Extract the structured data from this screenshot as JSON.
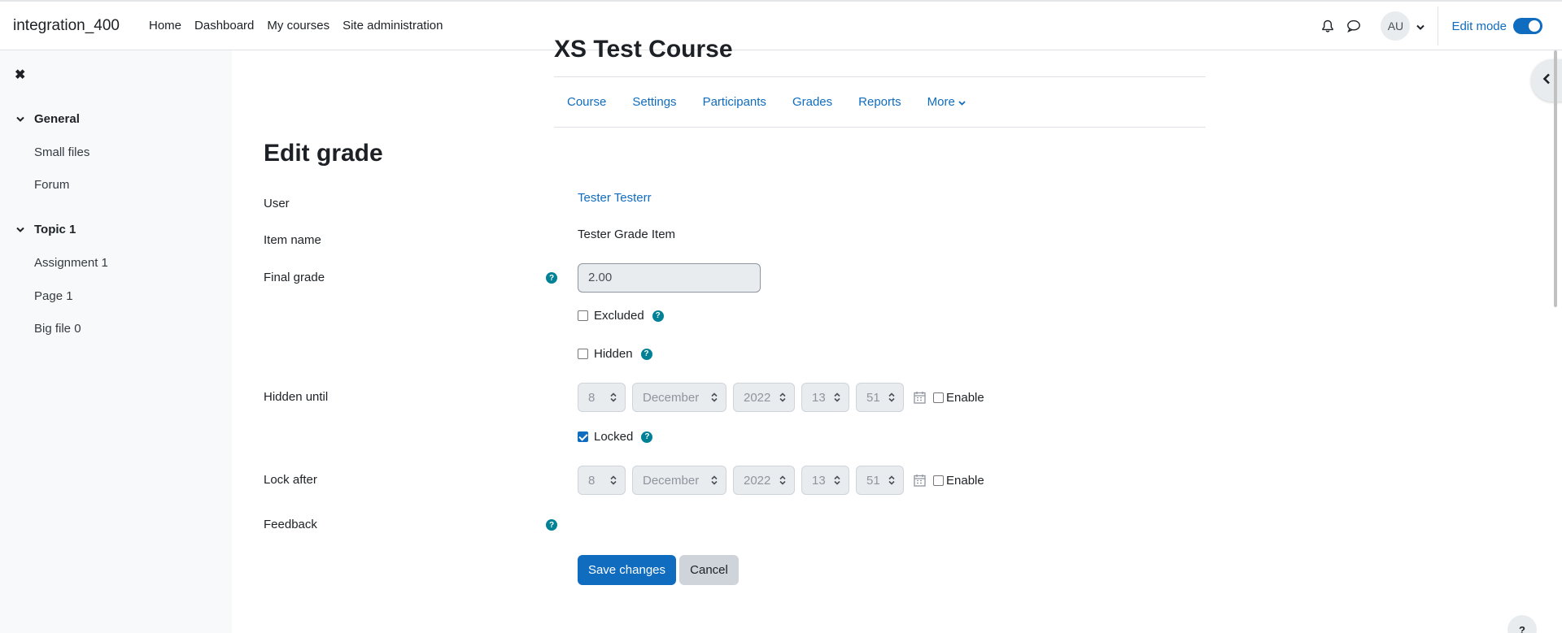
{
  "navbar": {
    "brand": "integration_400",
    "links": [
      "Home",
      "Dashboard",
      "My courses",
      "Site administration"
    ],
    "avatar_initials": "AU",
    "edit_mode_label": "Edit mode",
    "edit_mode_on": true
  },
  "drawer": {
    "close_icon": "close-icon",
    "sections": [
      {
        "title": "General",
        "items": [
          "Small files",
          "Forum"
        ]
      },
      {
        "title": "Topic 1",
        "items": [
          "Assignment 1",
          "Page 1",
          "Big file 0"
        ]
      }
    ]
  },
  "course": {
    "title": "XS Test Course",
    "tabs": [
      "Course",
      "Settings",
      "Participants",
      "Grades",
      "Reports",
      "More"
    ]
  },
  "form": {
    "page_title": "Edit grade",
    "user_label": "User",
    "user_value": "Tester Testerr",
    "item_name_label": "Item name",
    "item_name_value": "Tester Grade Item",
    "final_grade_label": "Final grade",
    "final_grade_value": "2.00",
    "excluded_label": "Excluded",
    "excluded_checked": false,
    "hidden_label": "Hidden",
    "hidden_checked": false,
    "hidden_until_label": "Hidden until",
    "hidden_until": {
      "day": "8",
      "month": "December",
      "year": "2022",
      "hour": "13",
      "minute": "51",
      "enable_label": "Enable",
      "enabled": false
    },
    "locked_label": "Locked",
    "locked_checked": true,
    "lock_after_label": "Lock after",
    "lock_after": {
      "day": "8",
      "month": "December",
      "year": "2022",
      "hour": "13",
      "minute": "51",
      "enable_label": "Enable",
      "enabled": false
    },
    "feedback_label": "Feedback",
    "save_label": "Save changes",
    "cancel_label": "Cancel"
  },
  "help_fab_label": "?",
  "colors": {
    "accent": "#0f6cbf",
    "help": "#008196"
  }
}
